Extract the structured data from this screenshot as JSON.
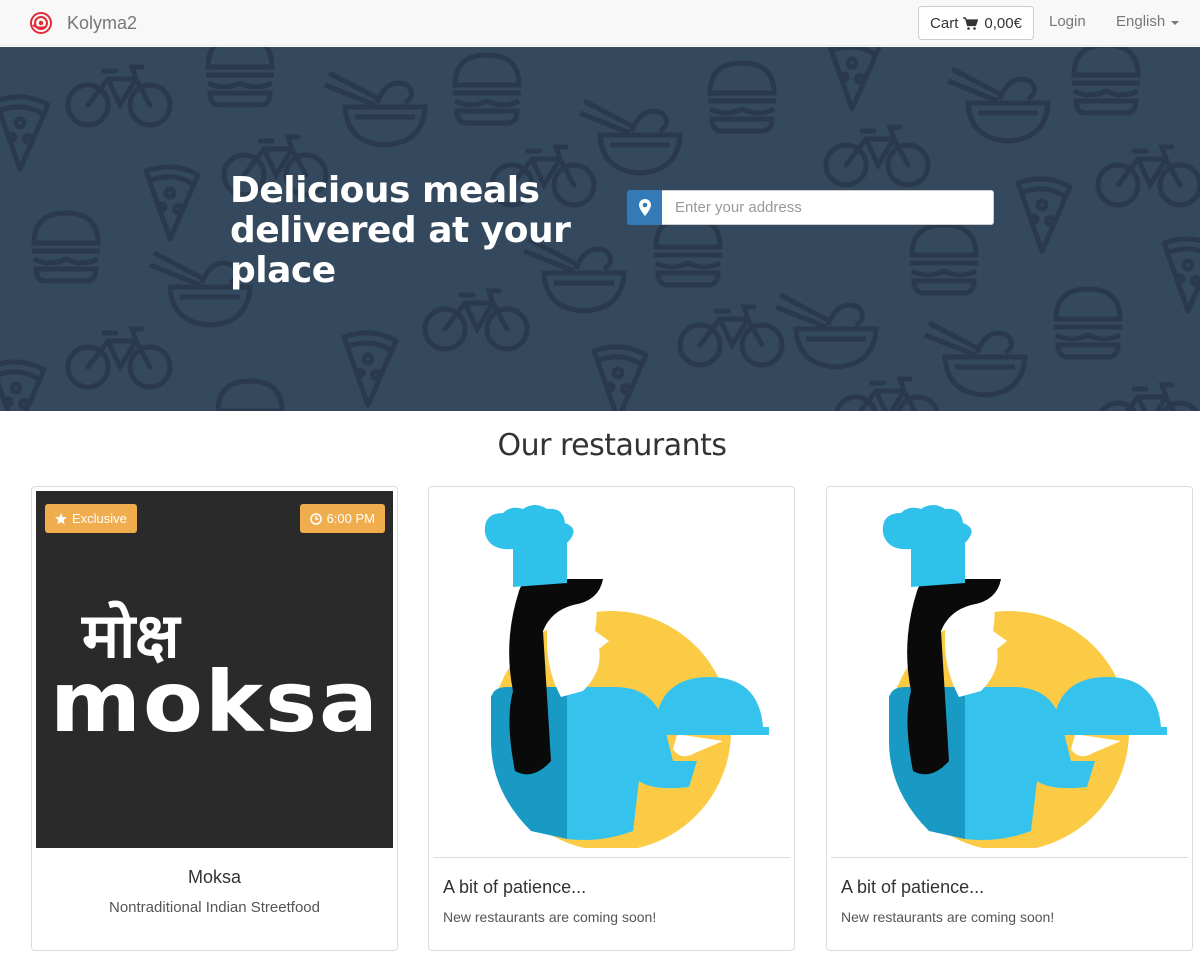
{
  "navbar": {
    "brand": "Kolyma2",
    "cart_label": "Cart",
    "cart_total": "0,00€",
    "login": "Login",
    "language": "English"
  },
  "hero": {
    "title": "Delicious meals delivered at your place",
    "address_placeholder": "Enter your address"
  },
  "restaurants_section": {
    "title": "Our restaurants",
    "cards": [
      {
        "name": "Moksa",
        "description": "Nontraditional Indian Streetfood",
        "badge_exclusive": "Exclusive",
        "badge_time": "6:00 PM",
        "logo_devanagari": "मोक्ष",
        "logo_latin": "moksa"
      },
      {
        "title": "A bit of patience...",
        "text": "New restaurants are coming soon!"
      },
      {
        "title": "A bit of patience...",
        "text": "New restaurants are coming soon!"
      }
    ]
  },
  "colors": {
    "hero_bg": "#34495e",
    "badge": "#f0ad4e",
    "addon_blue": "#337ab7",
    "brand_red": "#e12b38"
  }
}
